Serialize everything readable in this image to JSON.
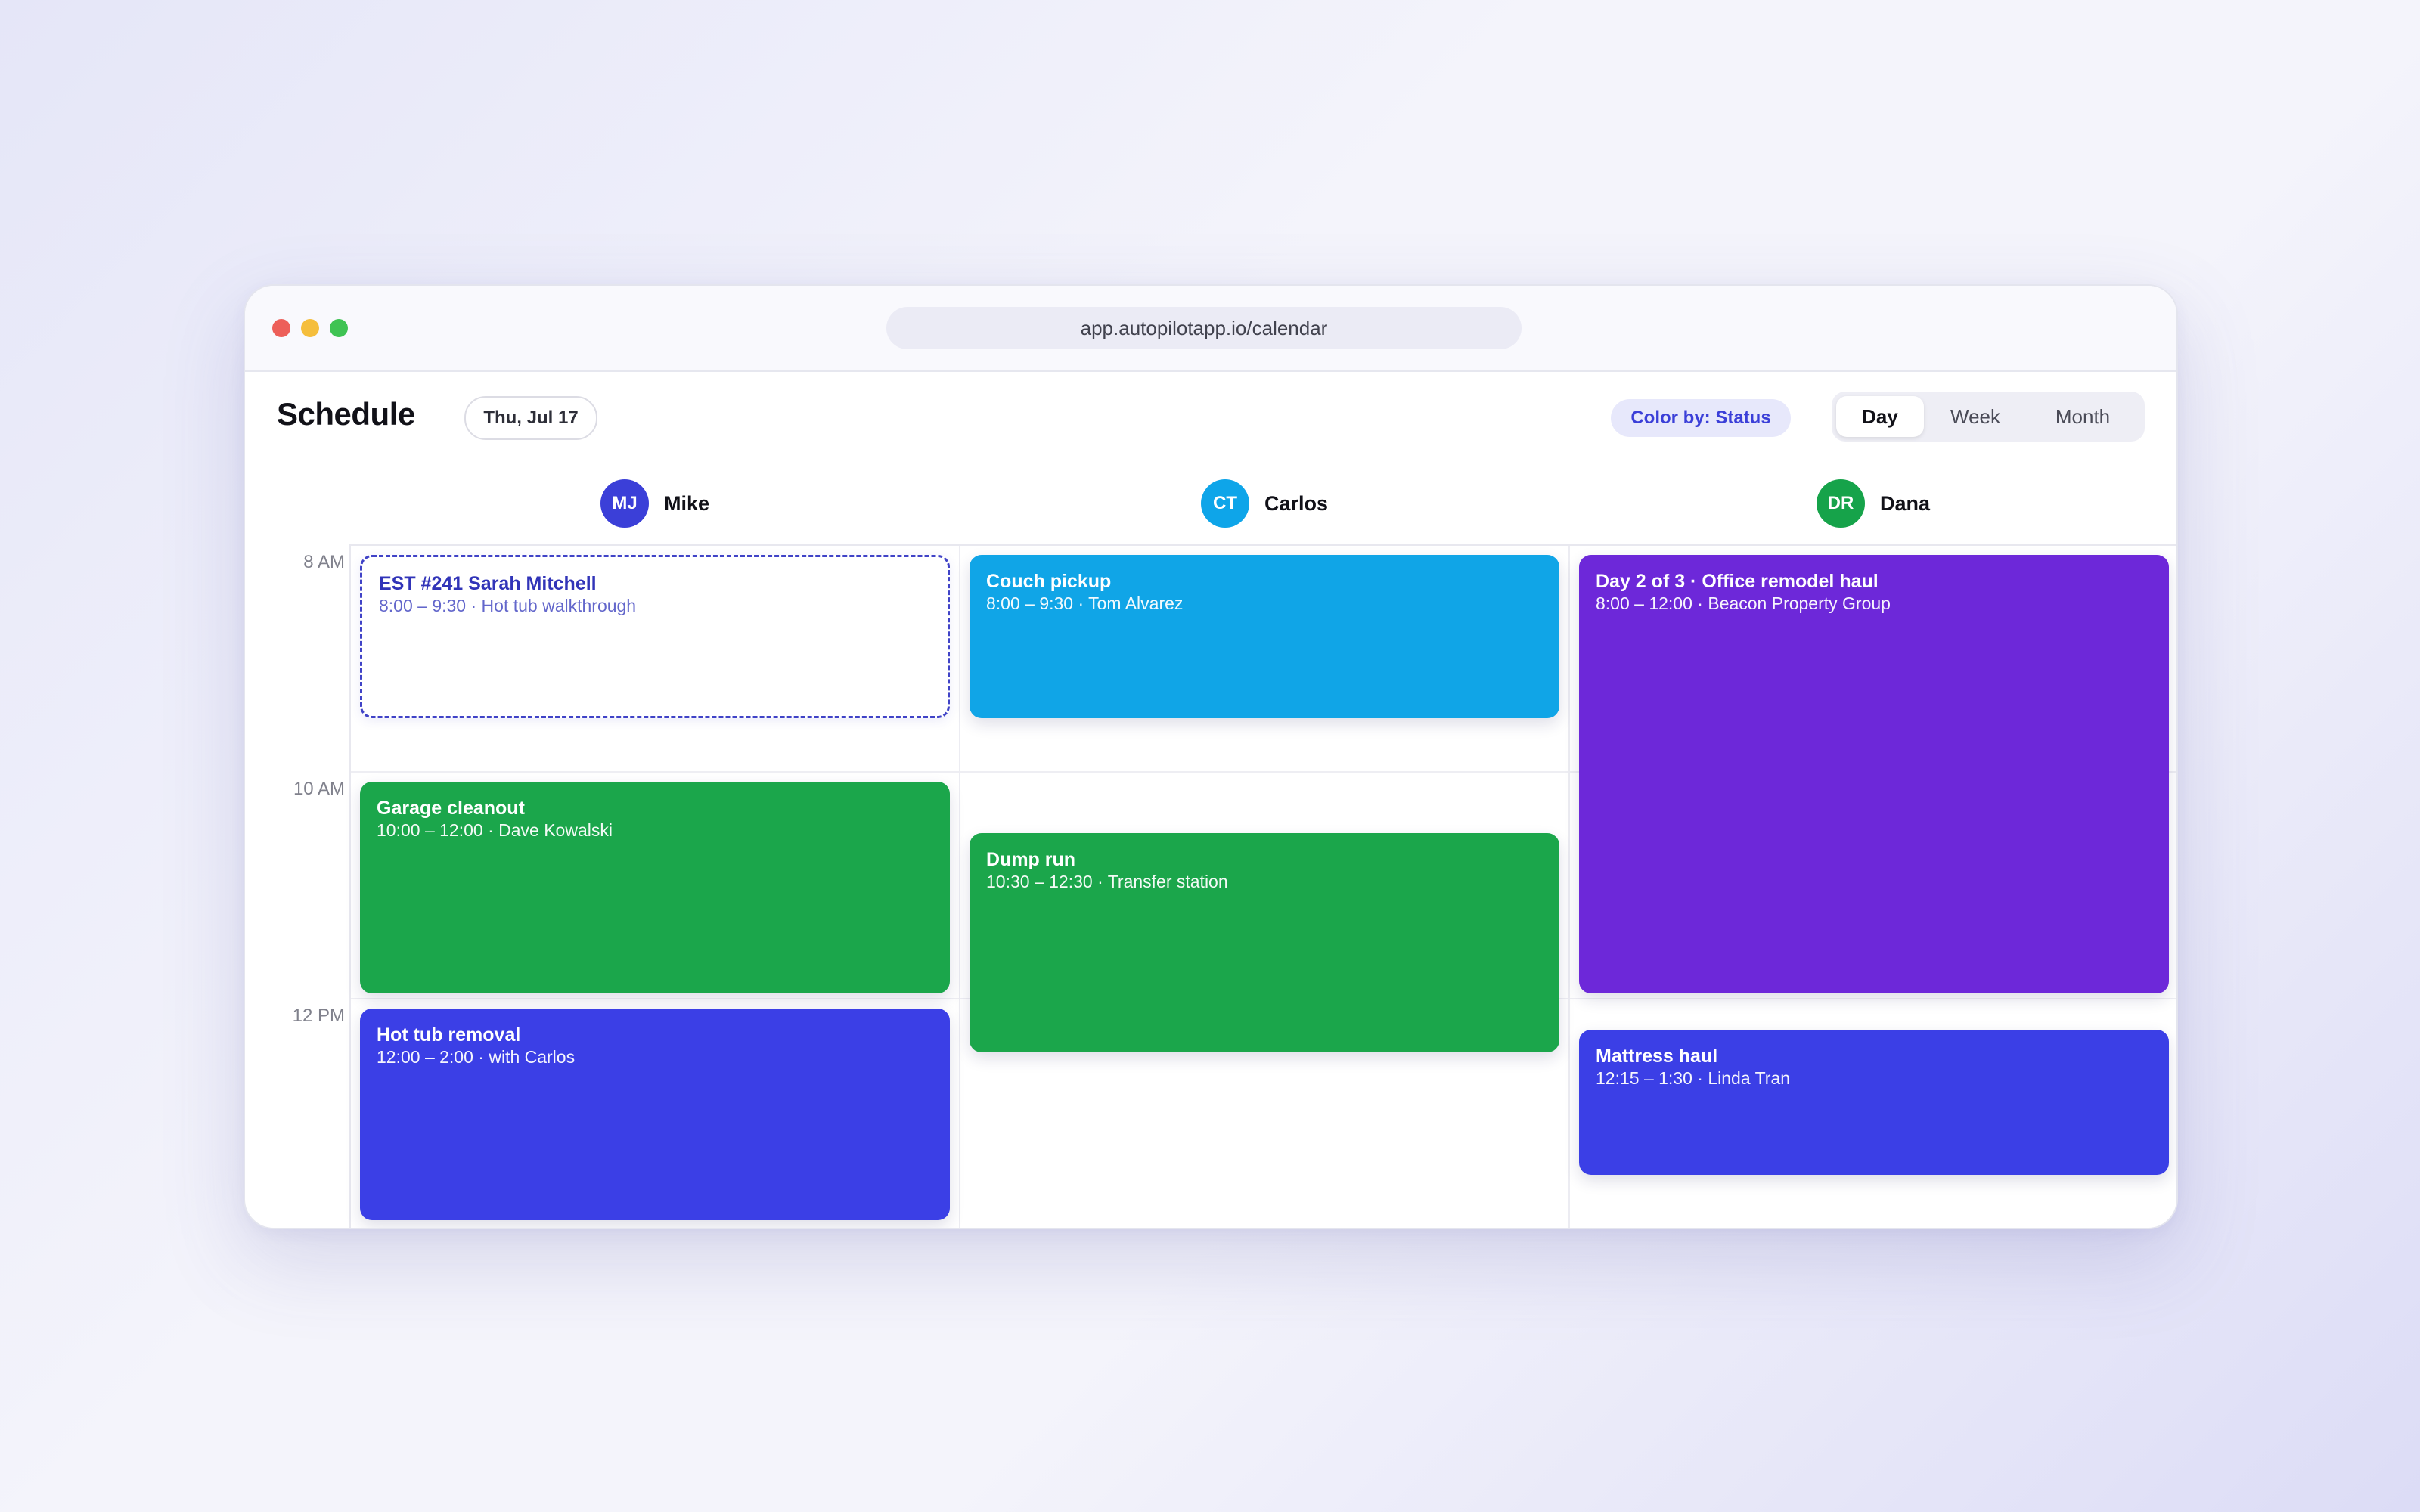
{
  "browser": {
    "url": "app.autopilotapp.io/calendar"
  },
  "header": {
    "title": "Schedule",
    "date": "Thu, Jul 17",
    "color_by": "Color by: Status",
    "views": [
      "Day",
      "Week",
      "Month"
    ],
    "active_view": "Day"
  },
  "time_labels": [
    "8 AM",
    "10 AM",
    "12 PM"
  ],
  "staff": [
    {
      "initials": "MJ",
      "name": "Mike",
      "color": "#3b3fd8"
    },
    {
      "initials": "CT",
      "name": "Carlos",
      "color": "#0ea5e9"
    },
    {
      "initials": "DR",
      "name": "Dana",
      "color": "#16a34a"
    }
  ],
  "colors": {
    "estimate_border": "#4043c7",
    "sky": "#10a5e7",
    "green": "#1ba64b",
    "purple": "#6d28d9",
    "indigo": "#3b3fe6"
  },
  "events": {
    "mike": [
      {
        "title": "EST #241 Sarah Mitchell",
        "subtitle": "8:00 – 9:30 · Hot tub walkthrough",
        "style": "estimate"
      },
      {
        "title": "Garage cleanout",
        "subtitle": "10:00 – 12:00 · Dave Kowalski",
        "color": "#1ba64b"
      },
      {
        "title": "Hot tub removal",
        "subtitle": "12:00 – 2:00 · with Carlos",
        "color": "#3b3fe6"
      }
    ],
    "carlos": [
      {
        "title": "Couch pickup",
        "subtitle": "8:00 – 9:30 · Tom Alvarez",
        "color": "#10a5e7"
      },
      {
        "title": "Dump run",
        "subtitle": "10:30 – 12:30 · Transfer station",
        "color": "#1ba64b"
      }
    ],
    "dana": [
      {
        "title": "Day 2 of 3 · Office remodel haul",
        "subtitle": "8:00 – 12:00 · Beacon Property Group",
        "color": "#6d28d9"
      },
      {
        "title": "Mattress haul",
        "subtitle": "12:15 – 1:30 · Linda Tran",
        "color": "#3b3fe6"
      }
    ]
  }
}
